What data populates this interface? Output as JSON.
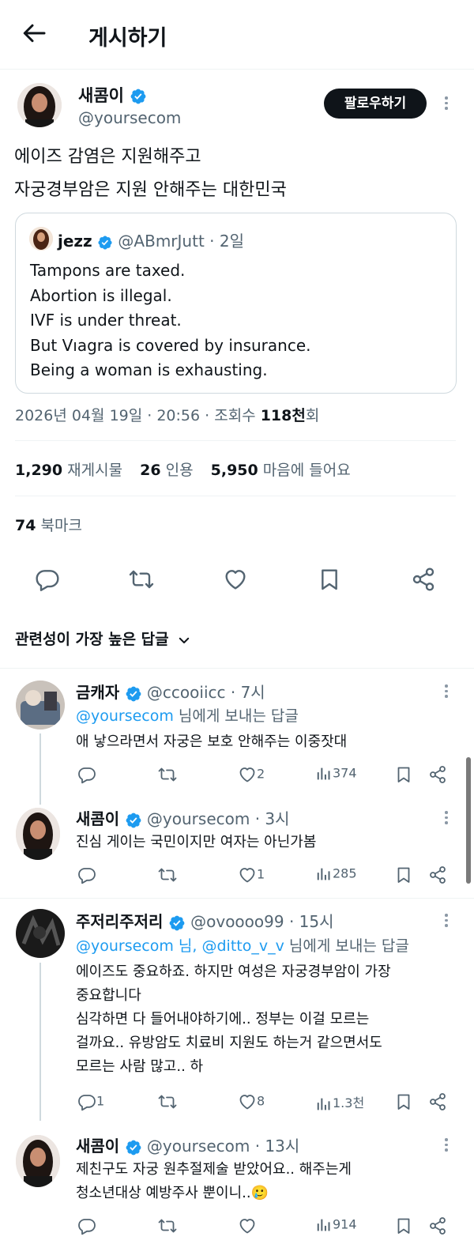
{
  "header": {
    "title": "게시하기"
  },
  "post": {
    "author_name": "새콤이",
    "author_handle": "@yoursecom",
    "follow_label": "팔로우하기",
    "text_line1": "에이즈 감염은 지원해주고",
    "text_line2": "자궁경부암은 지원 안해주는 대한민국",
    "quote": {
      "author_name": "jezz",
      "author_handle": "@ABmrJutt",
      "time": "· 2일",
      "lines": [
        "Tampons are taxed.",
        "Abortion is illegal.",
        "IVF is under threat.",
        "But Vıagra is covered by insurance.",
        "Being a woman is exhausting."
      ]
    },
    "meta_prefix": "2026년 04월 19일 · 20:56 · 조회수 ",
    "meta_views": "118천",
    "meta_suffix": "회",
    "stats": {
      "reposts_count": "1,290",
      "reposts_label": "재게시물",
      "quotes_count": "26",
      "quotes_label": "인용",
      "likes_count": "5,950",
      "likes_label": "마음에 들어요"
    },
    "bookmarks_count": "74",
    "bookmarks_label": "북마크"
  },
  "sort": {
    "label": "관련성이 가장 높은 답글"
  },
  "replies": [
    {
      "name": "금캐자",
      "handle": "@ccooiicc",
      "time": "· 7시",
      "mention_handle": "@yoursecom",
      "mention_suffix": " 님에게 보내는 답글",
      "lines": [
        "애 낳으라면서 자궁은 보호 안해주는 이중잣대"
      ],
      "likes": "2",
      "views": "374"
    },
    {
      "name": "새콤이",
      "handle": "@yoursecom",
      "time": "· 3시",
      "lines": [
        "진심 게이는 국민이지만 여자는 아닌가봄"
      ],
      "likes": "1",
      "views": "285"
    },
    {
      "name": "주저리주저리",
      "handle": "@ovoooo99",
      "time": "· 15시",
      "mention_handle": "@yoursecom 님, @ditto_v_v",
      "mention_suffix": " 님에게 보내는 답글",
      "lines": [
        "에이즈도 중요하죠. 하지만 여성은 자궁경부암이 가장",
        "중요합니다",
        "심각하면 다 들어내야하기에.. 정부는 이걸 모르는",
        "걸까요.. 유방암도 치료비 지원도 하는거 같으면서도",
        "모르는 사람 많고.. 하"
      ],
      "replies": "1",
      "likes": "8",
      "views": "1.3천"
    },
    {
      "name": "새콤이",
      "handle": "@yoursecom",
      "time": "· 13시",
      "lines": [
        "제친구도 자궁 원추절제술 받았어요.. 해주는게",
        "청소년대상 예방주사 뿐이니..🥲"
      ],
      "views": "914"
    }
  ]
}
